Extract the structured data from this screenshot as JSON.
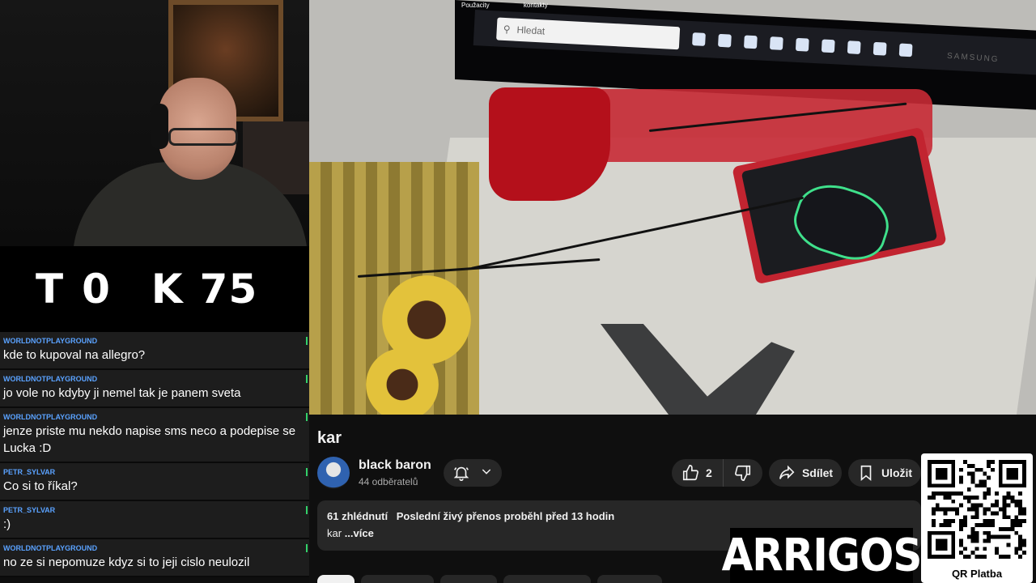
{
  "overlay": {
    "score": [
      "T",
      "0",
      "K",
      "75"
    ]
  },
  "chat": {
    "messages": [
      {
        "user": "WORLDNOTPLAYGROUND",
        "text": "kde to kupoval na allegro?"
      },
      {
        "user": "WORLDNOTPLAYGROUND",
        "text": "jo vole no kdyby ji nemel tak je panem sveta"
      },
      {
        "user": "WORLDNOTPLAYGROUND",
        "text": "jenze priste mu nekdo napise sms neco a podepise se Lucka :D"
      },
      {
        "user": "PETR_SYLVAR",
        "text": "Co si to říkal?"
      },
      {
        "user": "PETR_SYLVAR",
        "text": ":)"
      },
      {
        "user": "WORLDNOTPLAYGROUND",
        "text": "no ze si nepomuze kdyz si to jeji cislo neulozil"
      }
    ]
  },
  "video_scene": {
    "taskbar_search_placeholder": "Hledat",
    "screen_labels": [
      "Použacity",
      "kontakty"
    ],
    "monitor_brand": "SAMSUNG"
  },
  "video": {
    "title": "kar",
    "channel": {
      "name": "black baron",
      "subscribers": "44 odběratelů"
    },
    "actions": {
      "like_count": "2",
      "share_label": "Sdílet",
      "save_label": "Uložit"
    },
    "description": {
      "views": "61 zhlédnutí",
      "stream_info": "Poslední živý přenos proběhl před 13 hodin",
      "text": "kar",
      "more": "...více"
    }
  },
  "branding": {
    "logo_text": "ARRIGOS",
    "qr_label": "QR Platba"
  },
  "colors": {
    "chat_username": "#5aa2ff",
    "accent_green": "#33d16a",
    "pill_bg": "#272727"
  }
}
